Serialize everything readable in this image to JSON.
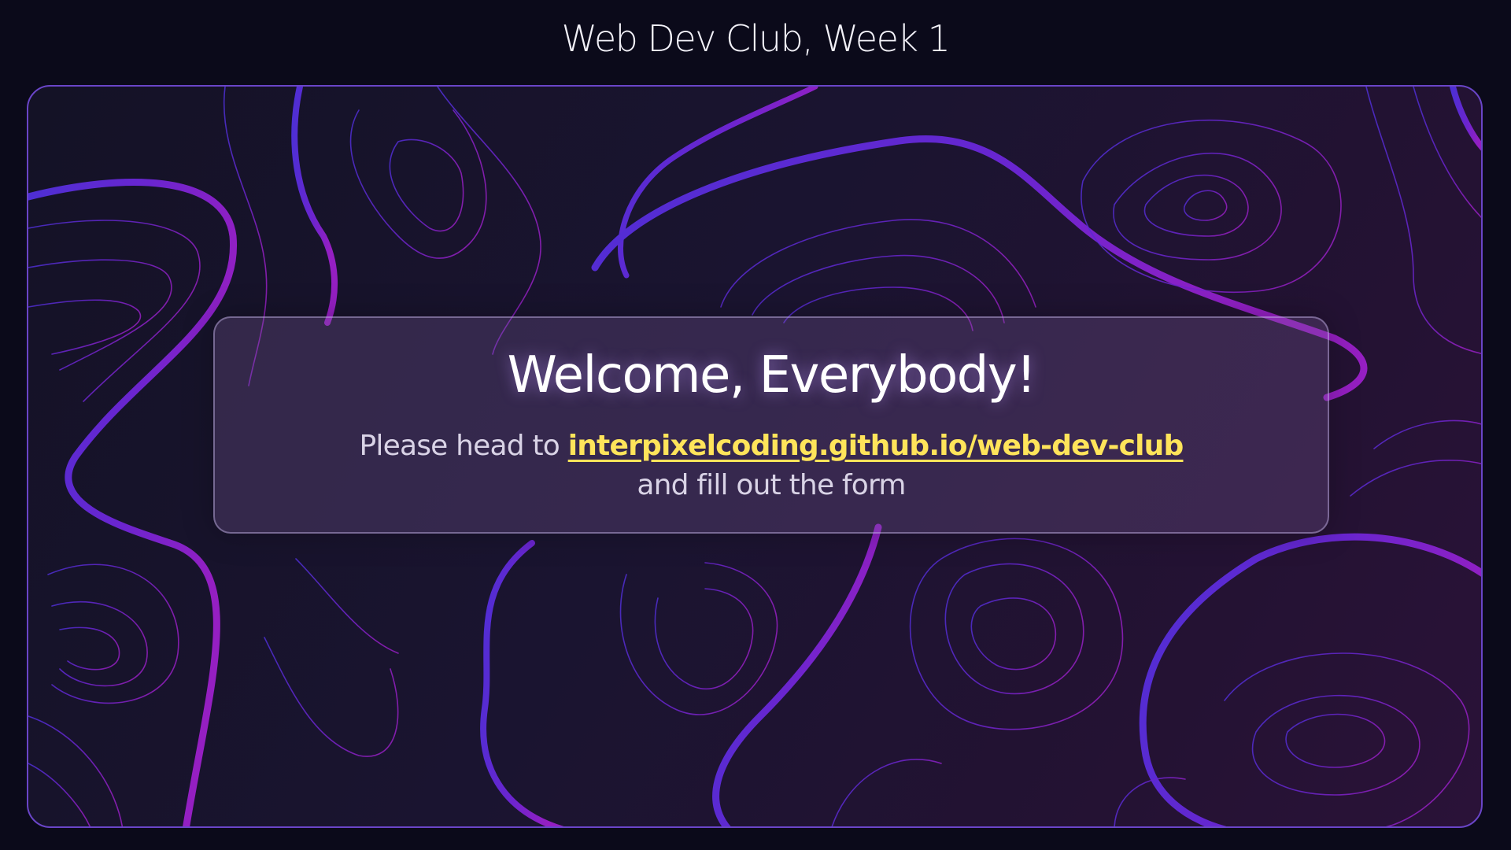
{
  "header": {
    "title": "Web Dev Club, Week 1"
  },
  "card": {
    "heading": "Welcome, Everybody!",
    "instruction_prefix": "Please head to",
    "link_text": "interpixelcoding.github.io/web-dev-club",
    "instruction_suffix": "and fill out the form"
  },
  "colors": {
    "background": "#0b0a1a",
    "frame_border": "#6a45c8",
    "link": "#ffe45a",
    "contour_blue": "#4a2fd0",
    "contour_purple": "#8a1fc0"
  }
}
